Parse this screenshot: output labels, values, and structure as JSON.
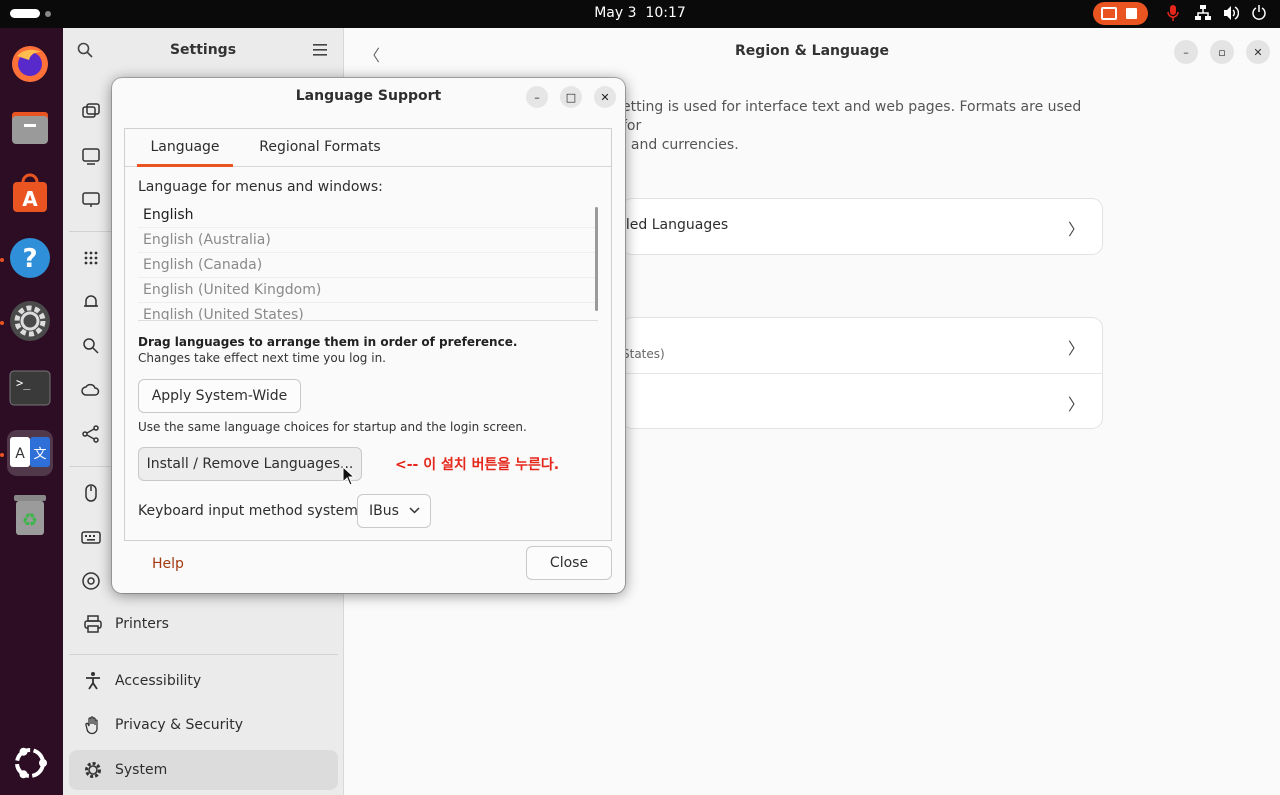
{
  "topbar": {
    "date": "May 3",
    "time": "10:17",
    "tray_icons": [
      "mic-icon",
      "network-icon",
      "volume-icon",
      "power-icon"
    ]
  },
  "dock": {
    "apps": [
      "firefox-icon",
      "files-icon",
      "app-center-icon",
      "help-icon",
      "settings-icon",
      "terminal-icon",
      "language-support-icon",
      "trash-icon"
    ],
    "show_apps_icon": "ubuntu-logo-icon"
  },
  "sidebar": {
    "title": "Settings",
    "items": [
      {
        "label": "Printers",
        "icon": "printer-icon"
      },
      {
        "label": "Accessibility",
        "icon": "accessibility-icon"
      },
      {
        "label": "Privacy & Security",
        "icon": "hand-icon"
      },
      {
        "label": "System",
        "icon": "gear-icon",
        "selected": true
      }
    ]
  },
  "main": {
    "title": "Region & Language",
    "desc_line1": "etting is used for interface text and web pages. Formats are used for",
    "desc_line2": ", and currencies.",
    "installed_languages": "lled Languages",
    "formats_sub": "States)"
  },
  "dialog": {
    "title": "Language Support",
    "tabs": [
      "Language",
      "Regional Formats"
    ],
    "menu_label": "Language for menus and windows:",
    "languages": [
      "English",
      "English (Australia)",
      "English (Canada)",
      "English (United Kingdom)",
      "English (United States)"
    ],
    "drag_hint_bold": "Drag languages to arrange them in order of preference.",
    "drag_hint": "Changes take effect next time you log in.",
    "apply_button": "Apply System-Wide",
    "apply_hint": "Use the same language choices for startup and the login screen.",
    "install_button": "Install / Remove Languages...",
    "annotation": "<-- 이 설치 버튼을 누른다.",
    "keyboard_label": "Keyboard input method system:",
    "keyboard_value": "IBus",
    "help": "Help",
    "close": "Close"
  },
  "colors": {
    "accent": "#e95420",
    "annotation": "#e5261a",
    "dock": "#2c0d24",
    "topbar": "#0a0a0a"
  }
}
